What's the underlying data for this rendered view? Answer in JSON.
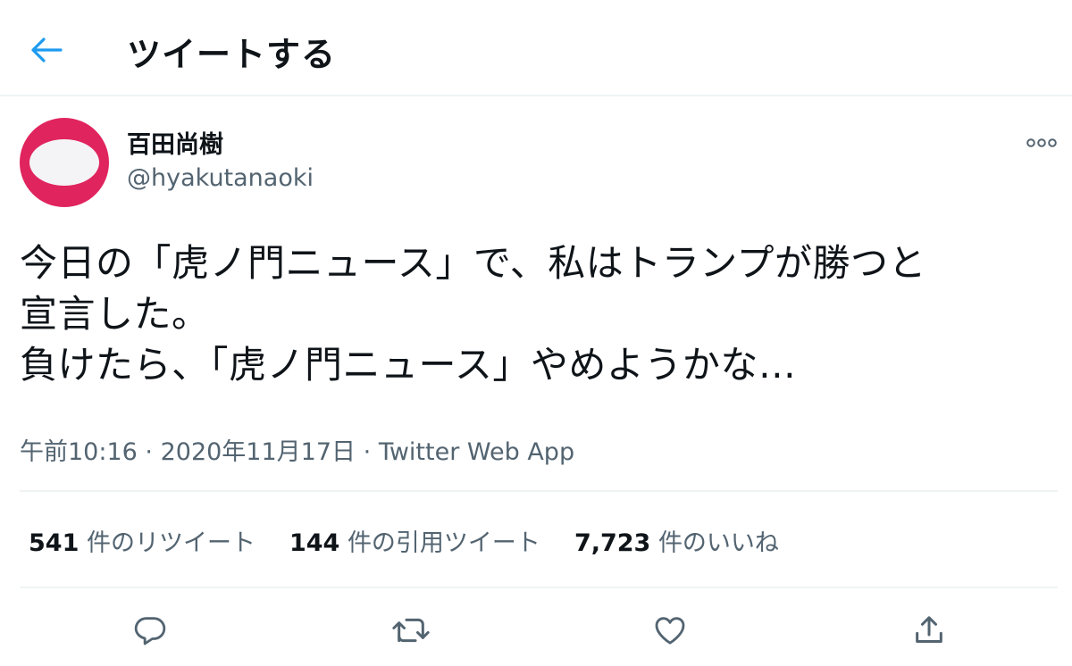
{
  "header": {
    "title": "ツイートする",
    "back_icon": "arrow-left-icon",
    "accent_color": "#1d9bf0"
  },
  "author": {
    "name": "百田尚樹",
    "handle": "@hyakutanaoki",
    "avatar_color": "#e0245e",
    "more_icon": "more-dots-icon"
  },
  "tweet": {
    "text": "今日の「虎ノ門ニュース」で、私はトランプが勝つと\n宣言した。\n負けたら、「虎ノ門ニュース」やめようかな…",
    "time": "午前10:16",
    "date": "2020年11月17日",
    "separator": "·",
    "source": "Twitter Web App"
  },
  "stats": {
    "retweets_count": "541",
    "retweets_label": "件のリツイート",
    "quotes_count": "144",
    "quotes_label": "件の引用ツイート",
    "likes_count": "7,723",
    "likes_label": "件のいいね"
  },
  "actions": {
    "reply_icon": "reply-icon",
    "retweet_icon": "retweet-icon",
    "like_icon": "heart-icon",
    "share_icon": "share-icon",
    "icon_color": "#536471"
  }
}
